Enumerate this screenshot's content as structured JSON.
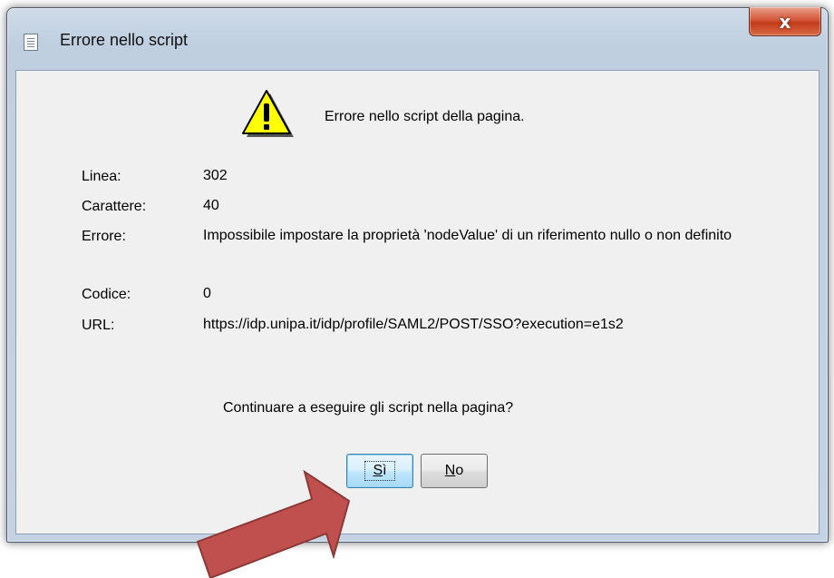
{
  "window": {
    "title": "Errore nello script",
    "close_glyph": "x"
  },
  "dialog": {
    "header_message": "Errore nello script della pagina.",
    "fields": [
      {
        "label": "Linea:",
        "value": "302"
      },
      {
        "label": "Carattere:",
        "value": "40"
      },
      {
        "label": "Errore:",
        "value": "Impossibile impostare la proprietà 'nodeValue' di un riferimento nullo o non definito"
      },
      {
        "label": "Codice:",
        "value": "0"
      },
      {
        "label": "URL:",
        "value": "https://idp.unipa.it/idp/profile/SAML2/POST/SSO?execution=e1s2"
      }
    ],
    "question": "Continuare a eseguire gli script nella pagina?",
    "buttons": {
      "yes_label": "Sì",
      "no_label": "No"
    }
  },
  "icons": {
    "window_icon": "document-icon",
    "message_icon": "warning-icon",
    "annotation": "arrow-pointer-icon"
  },
  "colors": {
    "arrow_fill": "#c0504d",
    "arrow_stroke": "#8c3836",
    "warning_fill": "#ffff00",
    "default_button_border": "#3c7fb1"
  }
}
